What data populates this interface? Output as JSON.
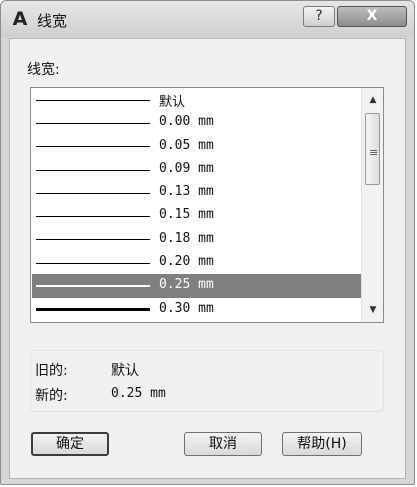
{
  "window": {
    "title": "线宽",
    "app_icon_glyph": "A",
    "help_glyph": "?",
    "close_glyph": "X"
  },
  "list": {
    "label": "线宽:",
    "selected_index": 8,
    "items": [
      {
        "label": "默认",
        "weight": 1
      },
      {
        "label": "0.00 mm",
        "weight": 1
      },
      {
        "label": "0.05 mm",
        "weight": 1
      },
      {
        "label": "0.09 mm",
        "weight": 1
      },
      {
        "label": "0.13 mm",
        "weight": 1
      },
      {
        "label": "0.15 mm",
        "weight": 1
      },
      {
        "label": "0.18 mm",
        "weight": 1
      },
      {
        "label": "0.20 mm",
        "weight": 1
      },
      {
        "label": "0.25 mm",
        "weight": 2
      },
      {
        "label": "0.30 mm",
        "weight": 3
      }
    ]
  },
  "info": {
    "old_label": "旧的:",
    "old_value": "默认",
    "new_label": "新的:",
    "new_value": "0.25 mm"
  },
  "buttons": {
    "ok": "确定",
    "cancel": "取消",
    "help": "帮助(H)"
  }
}
